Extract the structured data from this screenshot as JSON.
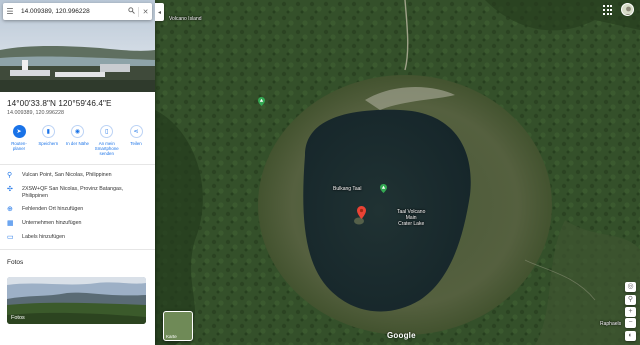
{
  "search": {
    "query": "14.009389, 120.996228"
  },
  "place": {
    "title": "14°00'33.8\"N 120°59'46.4\"E",
    "subtitle": "14.009389, 120.996228"
  },
  "actions": [
    {
      "label": "Routen-\nplaner",
      "icon": "directions-icon"
    },
    {
      "label": "Speichern",
      "icon": "bookmark-icon"
    },
    {
      "label": "In der Nähe",
      "icon": "nearby-icon"
    },
    {
      "label": "An mein\nSmartphone\nsenden",
      "icon": "phone-icon"
    },
    {
      "label": "Teilen",
      "icon": "share-icon"
    }
  ],
  "info_rows": {
    "location": "Vulcan Point, San Nicolas, Philippinen",
    "pluscode": "2XSW+QF San Nicolas, Provinz Batangas,\nPhilippinen",
    "add_missing": "Fehlenden Ort hinzufügen",
    "add_business": "Unternehmen hinzufügen",
    "add_label": "Labels hinzufügen"
  },
  "photos": {
    "heading": "Fotos",
    "card_caption": "Fotos"
  },
  "map": {
    "label_volcano_island": "Volcano Island",
    "label_bulkang_taal": "Bulkang Taal",
    "label_lake": "Taal Volcano\nMain\nCrater Lake",
    "label_raphaels": "Raphaels",
    "layers_label": "Karte",
    "brand": "Google",
    "zoom_in": "+",
    "zoom_out": "−"
  },
  "colors": {
    "accent": "#1a73e8",
    "pin": "#ea4335",
    "poi": "#34a853",
    "lake": "#1b2b2c",
    "forest": "#2f4a1f"
  }
}
